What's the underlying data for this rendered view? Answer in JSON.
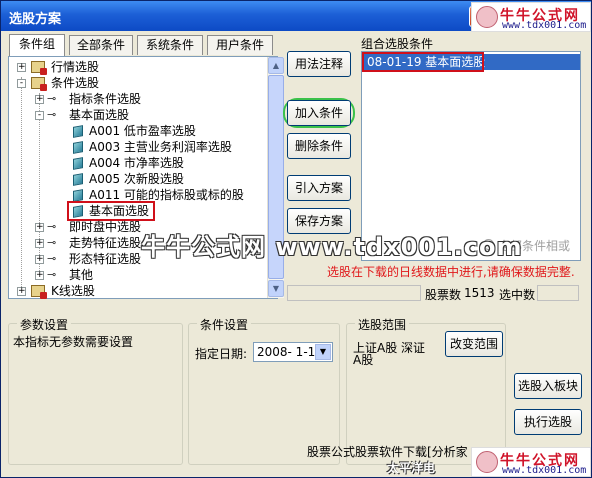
{
  "window": {
    "title": "选股方案",
    "close_label": "X"
  },
  "watermark": {
    "name": "牛牛公式网",
    "url": "www.tdx001.com",
    "big_text": "牛牛公式网 www.tdx001.com",
    "footer_fragment": "太平洋电"
  },
  "tabs": [
    {
      "label": "条件组",
      "active": true
    },
    {
      "label": "全部条件",
      "active": false
    },
    {
      "label": "系统条件",
      "active": false
    },
    {
      "label": "用户条件",
      "active": false
    }
  ],
  "tree": {
    "items": [
      {
        "label": "行情选股",
        "expander": "+"
      },
      {
        "label": "条件选股",
        "expander": "-"
      },
      {
        "label": "指标条件选股",
        "expander": "+"
      },
      {
        "label": "基本面选股",
        "expander": "-"
      },
      {
        "label": "A001 低市盈率选股"
      },
      {
        "label": "A003 主营业务利润率选股"
      },
      {
        "label": "A004 市净率选股"
      },
      {
        "label": "A005 次新股选股"
      },
      {
        "label": "A011 可能的指标股或标的股"
      },
      {
        "label": "基本面选股"
      },
      {
        "label": "即时盘中选股",
        "expander": "+"
      },
      {
        "label": "走势特征选股",
        "expander": "+"
      },
      {
        "label": "形态特征选股",
        "expander": "+"
      },
      {
        "label": "其他",
        "expander": "+"
      },
      {
        "label": "K线选股",
        "expander": "+"
      }
    ]
  },
  "buttons": {
    "usage": "用法注释",
    "add": "加入条件",
    "delete": "删除条件",
    "import": "引入方案",
    "save": "保存方案",
    "change_range": "改变范围",
    "to_block": "选股入板块",
    "execute": "执行选股"
  },
  "combo": {
    "group_label": "组合选股条件",
    "items": [
      "08-01-19 基本面选股"
    ]
  },
  "options": {
    "all_conditions": "全部条件相或"
  },
  "note": "选股在下载的日线数据中进行,请确保数据完整.",
  "status": {
    "stock_count_label": "股票数",
    "stock_count": "1513",
    "selected_label": "选中数"
  },
  "params": {
    "title": "参数设置",
    "text": "本指标无参数需要设置"
  },
  "condition_settings": {
    "title": "条件设置",
    "date_label": "指定日期:",
    "date_value": "2008- 1-19"
  },
  "scope": {
    "title": "选股范围",
    "line1": "上证A股 深证",
    "line2": "A股"
  },
  "footer": {
    "text": "股票公式股票软件下载[分析家"
  }
}
